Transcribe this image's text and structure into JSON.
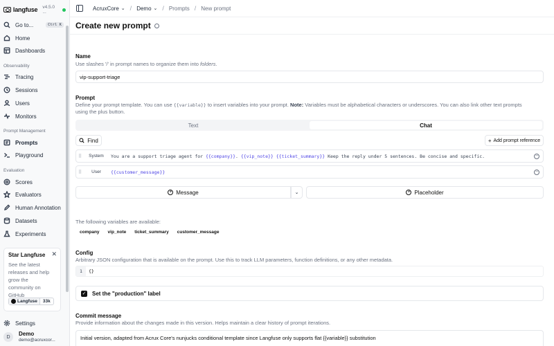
{
  "app": {
    "name": "langfuse",
    "version": "v4.5.0 ..."
  },
  "sidebar": {
    "goto": {
      "label": "Go to...",
      "shortcut": "Ctrl K"
    },
    "items_top": [
      {
        "label": "Home",
        "icon": "home-icon"
      },
      {
        "label": "Dashboards",
        "icon": "dashboard-icon"
      }
    ],
    "section_observability": "Observability",
    "items_observability": [
      {
        "label": "Tracing",
        "icon": "tracing-icon"
      },
      {
        "label": "Sessions",
        "icon": "sessions-icon"
      },
      {
        "label": "Users",
        "icon": "users-icon"
      },
      {
        "label": "Monitors",
        "icon": "monitors-icon"
      }
    ],
    "section_prompt": "Prompt Management",
    "items_prompt": [
      {
        "label": "Prompts",
        "icon": "prompts-icon"
      },
      {
        "label": "Playground",
        "icon": "playground-icon"
      }
    ],
    "section_evaluation": "Evaluation",
    "items_evaluation": [
      {
        "label": "Scores",
        "icon": "scores-icon"
      },
      {
        "label": "Evaluators",
        "icon": "evaluators-icon"
      },
      {
        "label": "Human Annotation",
        "icon": "human-annotation-icon"
      },
      {
        "label": "Datasets",
        "icon": "datasets-icon"
      },
      {
        "label": "Experiments",
        "icon": "experiments-icon"
      }
    ],
    "star_card": {
      "title": "Star Langfuse",
      "description": "See the latest releases and help grow the community on GitHub",
      "badge_label": "Langfuse",
      "badge_count": "33k"
    },
    "settings": "Settings",
    "user": {
      "initial": "D",
      "name": "Demo",
      "email": "demo@acruxcor..."
    }
  },
  "breadcrumb": {
    "org": "AcruxCore",
    "project": "Demo",
    "section": "Prompts",
    "page": "New prompt"
  },
  "page": {
    "title": "Create new prompt"
  },
  "name_field": {
    "label": "Name",
    "help_pre": "Use slashes '/' in prompt names to organize them into ",
    "help_em": "folders",
    "help_post": ".",
    "value": "vip-support-triage"
  },
  "prompt": {
    "label": "Prompt",
    "help_a": "Define your prompt template. You can use ",
    "help_var": "{{variable}}",
    "help_b": " to insert variables into your prompt. ",
    "help_note": "Note:",
    "help_c": " Variables must be alphabetical characters or underscores. You can also link other text prompts",
    "help_d": "using the plus button.",
    "tabs": [
      "Text",
      "Chat"
    ],
    "find_label": "Find",
    "add_ref_label": "Add prompt reference",
    "messages": [
      {
        "role": "System",
        "parts": [
          {
            "t": "You are a support triage agent for ",
            "v": false
          },
          {
            "t": "{{company}}",
            "v": true
          },
          {
            "t": ". ",
            "v": false
          },
          {
            "t": "{{vip_note}}",
            "v": true
          },
          {
            "t": " ",
            "v": false
          },
          {
            "t": "{{ticket_summary}}",
            "v": true
          },
          {
            "t": " Keep the reply under 5 sentences. Be concise and specific.",
            "v": false
          }
        ]
      },
      {
        "role": "User",
        "parts": [
          {
            "t": "{{customer_message}}",
            "v": true
          }
        ]
      }
    ],
    "message_btn": "Message",
    "placeholder_btn": "Placeholder"
  },
  "variables": {
    "intro": "The following variables are available:",
    "list": [
      "company",
      "vip_note",
      "ticket_summary",
      "customer_message"
    ]
  },
  "config": {
    "label": "Config",
    "help": "Arbitrary JSON configuration that is available on the prompt. Use this to track LLM parameters, function definitions, or any other metadata.",
    "line_number": "1",
    "value": "{}"
  },
  "production_label": {
    "label": "Set the \"production\" label",
    "checked": true
  },
  "commit": {
    "label": "Commit message",
    "help": "Provide information about the changes made in this version. Helps maintain a clear history of prompt iterations.",
    "value": "Initial version, adapted from Acrux Core's nunjucks conditional template since Langfuse only supports flat {{variable}} substitution"
  }
}
